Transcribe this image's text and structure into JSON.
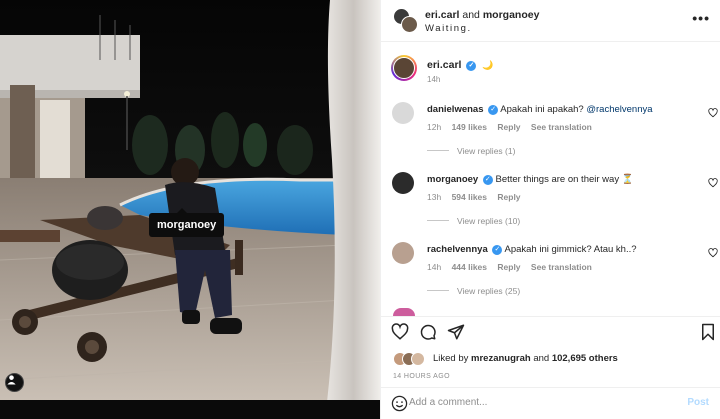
{
  "photo": {
    "tag_label": "morganoey",
    "tags_icon": "user-tag-icon"
  },
  "header": {
    "user1": "eri.carl",
    "connector": "and",
    "user2": "morganoey",
    "subtitle": "Waiting.",
    "more_icon": "more-horizontal-icon"
  },
  "caption": {
    "username": "eri.carl",
    "verified_icon": "verified-badge-icon",
    "emoji": "🌙",
    "time": "14h"
  },
  "comments": [
    {
      "username": "danielwenas",
      "text": "Apakah ini apakah?",
      "mention": "@rachelvennya",
      "time": "12h",
      "likes": "149 likes",
      "reply": "Reply",
      "translate": "See translation",
      "view_replies": "View replies (1)",
      "avatar_color": "#d9d9d9"
    },
    {
      "username": "morganoey",
      "text": "Better things are on their way ⏳",
      "mention": "",
      "time": "13h",
      "likes": "594 likes",
      "reply": "Reply",
      "translate": "",
      "view_replies": "View replies (10)",
      "avatar_color": "#2b2b2b"
    },
    {
      "username": "rachelvennya",
      "text": "Apakah ini gimmick? Atau kh..?",
      "mention": "",
      "time": "14h",
      "likes": "444 likes",
      "reply": "Reply",
      "translate": "See translation",
      "view_replies": "View replies (25)",
      "avatar_color": "#b8a090"
    }
  ],
  "actions": {
    "like_icon": "heart-icon",
    "comment_icon": "comment-icon",
    "share_icon": "send-icon",
    "save_icon": "bookmark-icon"
  },
  "likes": {
    "prefix": "Liked by",
    "user": "mrezanugrah",
    "and": "and",
    "count": "102,695 others"
  },
  "post_time": "14 HOURS AGO",
  "add_comment": {
    "emoji_icon": "smiley-icon",
    "placeholder": "Add a comment...",
    "post_label": "Post"
  },
  "colors": {
    "verified": "#3897f0",
    "mention": "#00376b",
    "post_button": "#b3dbff",
    "muted": "#8e8e8e"
  }
}
